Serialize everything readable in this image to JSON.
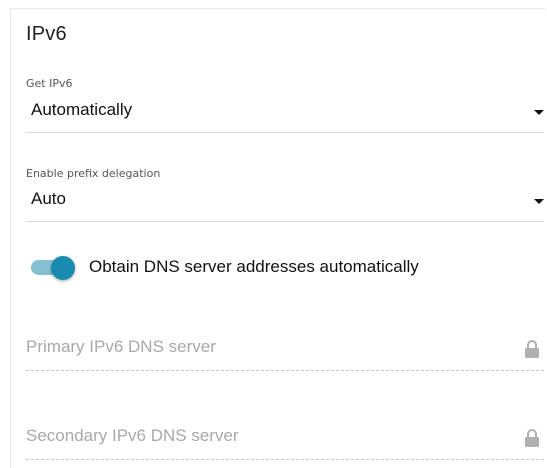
{
  "section": {
    "title": "IPv6"
  },
  "get_ipv6": {
    "label": "Get IPv6",
    "value": "Automatically"
  },
  "prefix_delegation": {
    "label": "Enable prefix delegation",
    "value": "Auto"
  },
  "dns_toggle": {
    "label": "Obtain DNS server addresses automatically",
    "enabled": true
  },
  "primary_dns": {
    "placeholder": "Primary IPv6 DNS server",
    "locked": true
  },
  "secondary_dns": {
    "placeholder": "Secondary IPv6 DNS server",
    "locked": true
  },
  "colors": {
    "accent": "#1a8bb0",
    "track": "#85c0d2",
    "placeholder": "#a8a8a8",
    "icon": "#b0b0b0"
  },
  "icons": {
    "dropdown": "caret-down-icon",
    "lock": "lock-icon"
  }
}
